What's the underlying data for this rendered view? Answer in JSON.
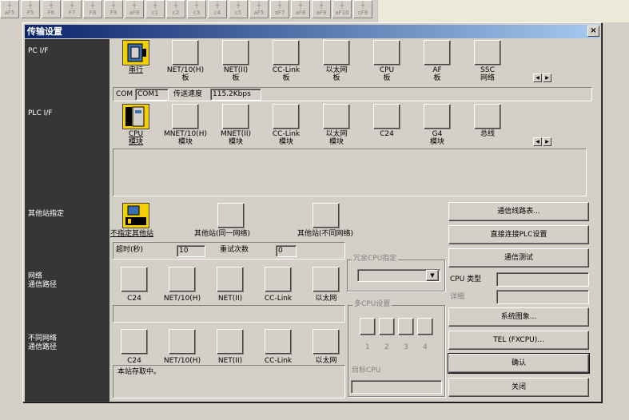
{
  "toolbar": {
    "items": [
      "aF5",
      "F5",
      "F6",
      "F7",
      "F8",
      "F9",
      "aF9",
      "c1",
      "c2",
      "c3",
      "c4",
      "c5",
      "aF5",
      "aF7",
      "aF8",
      "aF9",
      "aF10",
      "cF9"
    ]
  },
  "dialog": {
    "title": "传输设置",
    "close": "×",
    "sections": {
      "pc_if": "PC I/F",
      "plc_if": "PLC I/F",
      "other_station": "其他站指定",
      "network_route": "网络\n通信路径",
      "diff_network_route": "不同网络\n通信路径"
    },
    "pc_if": {
      "icons": [
        "串行",
        "NET/10(H)\n板",
        "NET(II)\n板",
        "CC-Link\n板",
        "以太网\n板",
        "CPU\n板",
        "AF\n板",
        "SSC\n网络"
      ],
      "com_label": "COM",
      "com_value": "COM1",
      "speed_label": "传送速度",
      "speed_value": "115.2Kbps"
    },
    "plc_if": {
      "icons": [
        "CPU\n模块",
        "MNET/10(H)\n模块",
        "MNET(II)\n模块",
        "CC-Link\n模块",
        "以太网\n模块",
        "C24",
        "G4\n模块",
        "总线"
      ]
    },
    "other_station": {
      "icons": [
        "不指定其他站",
        "其他站(同一网络)",
        "其他站(不同网络)"
      ],
      "timeout_label": "超时(秒)",
      "timeout_value": "10",
      "retry_label": "重试次数",
      "retry_value": "0"
    },
    "redundant_cpu": {
      "title": "冗余CPU指定"
    },
    "network_route": {
      "icons": [
        "C24",
        "NET/10(H)",
        "NET(II)",
        "CC-Link",
        "以太网"
      ]
    },
    "multi_cpu": {
      "title": "多CPU设置",
      "numbers": [
        "1",
        "2",
        "3",
        "4"
      ],
      "target_label": "目标CPU"
    },
    "diff_network_route": {
      "icons": [
        "C24",
        "NET/10(H)",
        "NET(II)",
        "CC-Link",
        "以太网"
      ],
      "status": "本站存取中。"
    },
    "buttons": {
      "route_table": "通信线路表...",
      "direct_plc": "直接连接PLC设置",
      "comm_test": "通信测试",
      "cpu_type_label": "CPU 类型",
      "detail_label": "详细",
      "system_image": "系统图象...",
      "tel": "TEL (FXCPU)...",
      "ok": "确认",
      "close": "关闭"
    }
  }
}
